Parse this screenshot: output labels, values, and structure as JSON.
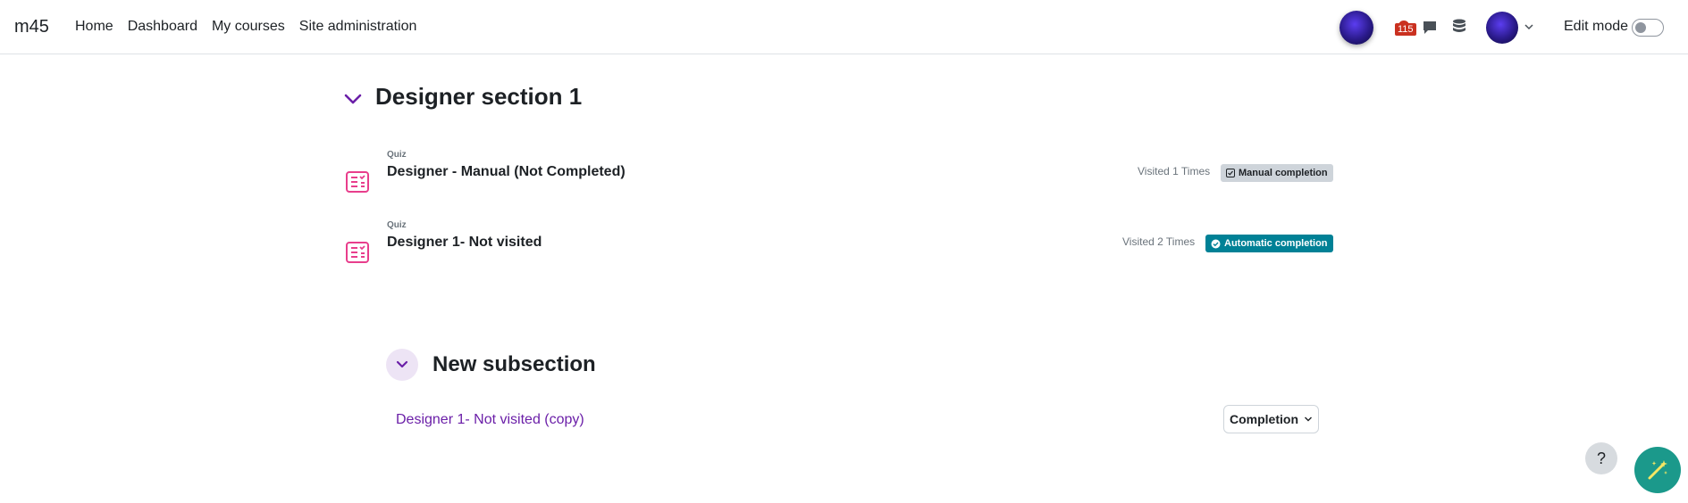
{
  "navbar": {
    "brand": "m45",
    "links": [
      "Home",
      "Dashboard",
      "My courses",
      "Site administration"
    ],
    "notification_count": "115",
    "edit_mode_label": "Edit mode"
  },
  "section": {
    "title": "Designer section 1",
    "activities": [
      {
        "type": "Quiz",
        "name": "Designer - Manual (Not Completed)",
        "visited": "Visited 1 Times",
        "completion": "Manual completion"
      },
      {
        "type": "Quiz",
        "name": "Designer 1- Not visited",
        "visited": "Visited 2 Times",
        "completion": "Automatic completion"
      }
    ]
  },
  "subsection": {
    "title": "New subsection",
    "link": "Designer 1- Not visited (copy)",
    "completion_button": "Completion"
  },
  "floating": {
    "help_label": "?"
  },
  "colors": {
    "accent_purple": "#6b1fa8",
    "automatic_badge": "#008196",
    "manual_badge": "#ced4da",
    "quiz_icon": "#e83e8c",
    "notification_badge": "#ca3120",
    "magic_button": "#1b998b"
  }
}
